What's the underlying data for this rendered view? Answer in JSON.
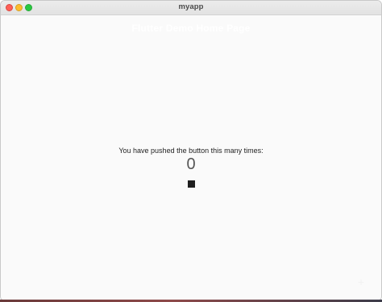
{
  "window": {
    "title": "myapp",
    "controls": [
      {
        "icon": "close-icon",
        "color": "#ff5f57"
      },
      {
        "icon": "minimize-icon",
        "color": "#febc2e"
      },
      {
        "icon": "zoom-icon",
        "color": "#28c840"
      }
    ]
  },
  "appbar": {
    "title": "Flutter Demo Home Page",
    "text_color": "#ffffff"
  },
  "main": {
    "message": "You have pushed the button this many times:",
    "counter": "0",
    "square_color": "#1e1e1e"
  },
  "fab": {
    "icon": "plus-icon",
    "label": "+"
  },
  "colors": {
    "background": "#fafafa",
    "titlebar": "#e8e8e8"
  }
}
